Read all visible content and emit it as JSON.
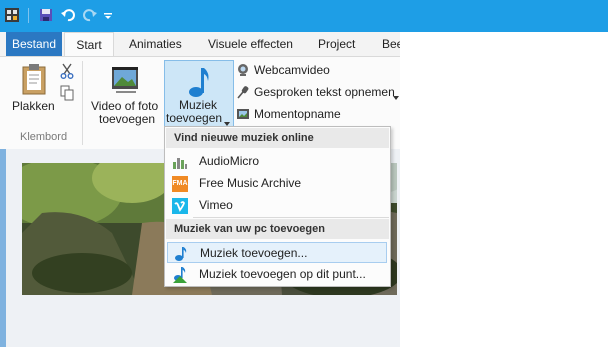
{
  "colors": {
    "titlebar": "#1e9ee6",
    "file_tab": "#2b78c2",
    "highlight": "#cde6f7"
  },
  "tabs": {
    "file": "Bestand",
    "start": "Start",
    "animaties": "Animaties",
    "visuele": "Visuele effecten",
    "project": "Project",
    "more": "Bee"
  },
  "ribbon": {
    "plakken": "Plakken",
    "klembord": "Klembord",
    "video_line1": "Video of foto",
    "video_line2": "toevoegen",
    "muziek_line1": "Muziek",
    "muziek_line2": "toevoegen",
    "webcam": "Webcamvideo",
    "gesproken": "Gesproken tekst opnemen",
    "moment": "Momentopname"
  },
  "menu": {
    "section1": "Vind nieuwe muziek online",
    "audiomicro": "AudioMicro",
    "fma": "Free Music Archive",
    "fma_icon_text": "FMA",
    "vimeo": "Vimeo",
    "section2": "Muziek van uw pc toevoegen",
    "add_music": "Muziek toevoegen...",
    "add_music_here": "Muziek toevoegen op dit punt..."
  }
}
